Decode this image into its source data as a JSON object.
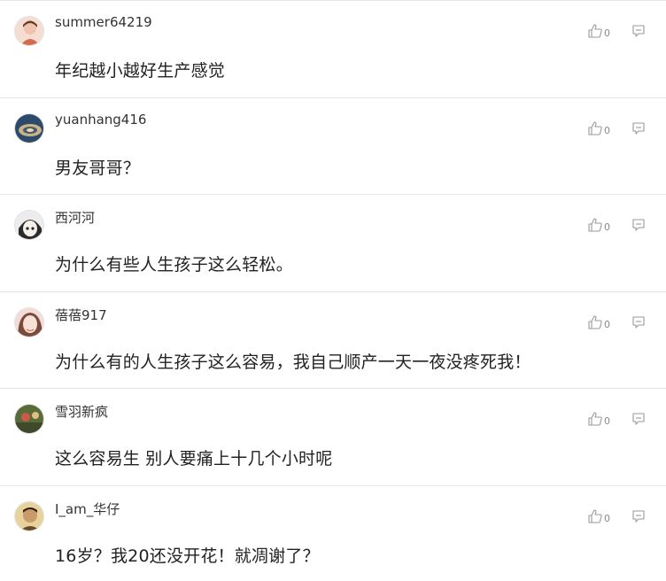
{
  "comments": [
    {
      "username": "summer64219",
      "text": "年纪越小越好生产感觉",
      "likes": "0",
      "avatar_colors": [
        "#f3c9b8",
        "#d36b4f"
      ]
    },
    {
      "username": "yuanhang416",
      "text": "男友哥哥？",
      "likes": "0",
      "avatar_colors": [
        "#2e4a6b",
        "#c9b48a"
      ]
    },
    {
      "username": "西河河",
      "text": "为什么有些人生孩子这么轻松。",
      "likes": "0",
      "avatar_colors": [
        "#e8e8e8",
        "#3a3a3a"
      ]
    },
    {
      "username": "蓓蓓917",
      "text": "为什么有的人生孩子这么容易，我自己顺产一天一夜没疼死我！",
      "likes": "0",
      "avatar_colors": [
        "#f1d2cf",
        "#8b5a4a"
      ]
    },
    {
      "username": "雪羽新疯",
      "text": "这么容易生 别人要痛上十几个小时呢",
      "likes": "0",
      "avatar_colors": [
        "#5a6b3a",
        "#c85a4a"
      ]
    },
    {
      "username": "I_am_华仔",
      "text": "16岁？我20还没开花！就凋谢了？",
      "likes": "0",
      "avatar_colors": [
        "#d9c27a",
        "#6b4a2a"
      ]
    }
  ],
  "icons": {
    "like": "thumbs-up-icon",
    "reply": "reply-bubble-icon"
  }
}
